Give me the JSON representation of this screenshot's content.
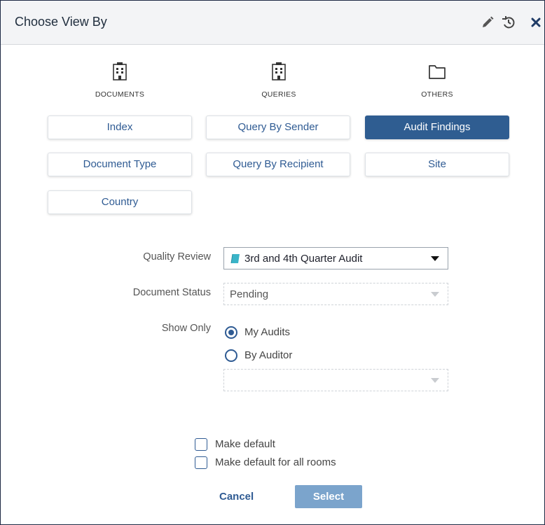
{
  "dialog": {
    "title": "Choose View By"
  },
  "header_icons": [
    "pencil-icon",
    "history-icon",
    "close-icon"
  ],
  "categories": [
    {
      "label": "DOCUMENTS",
      "icon": "building-icon"
    },
    {
      "label": "QUERIES",
      "icon": "building-icon"
    },
    {
      "label": "OTHERS",
      "icon": "folder-icon"
    }
  ],
  "view_buttons": {
    "index": "Index",
    "document_type": "Document Type",
    "country": "Country",
    "query_by_sender": "Query By Sender",
    "query_by_recipient": "Query By Recipient",
    "audit_findings": "Audit Findings",
    "site": "Site",
    "selected": "Audit Findings"
  },
  "form": {
    "quality_review": {
      "label": "Quality Review",
      "value": "3rd and 4th Quarter Audit"
    },
    "document_status": {
      "label": "Document Status",
      "value": "Pending"
    },
    "show_only": {
      "label": "Show Only",
      "options": [
        "My Audits",
        "By Auditor"
      ],
      "selected": "My Audits"
    },
    "auditor": {
      "value": ""
    }
  },
  "defaults": {
    "make_default": {
      "label": "Make default",
      "checked": false
    },
    "make_default_all": {
      "label": "Make default for all rooms",
      "checked": false
    }
  },
  "actions": {
    "cancel": "Cancel",
    "select": "Select"
  },
  "colors": {
    "accent": "#2f5d91",
    "link": "#2f5b93",
    "select_button": "#7ba4cc",
    "header_bg": "#f3f4f6",
    "book_icon": "#3ab4c8"
  }
}
